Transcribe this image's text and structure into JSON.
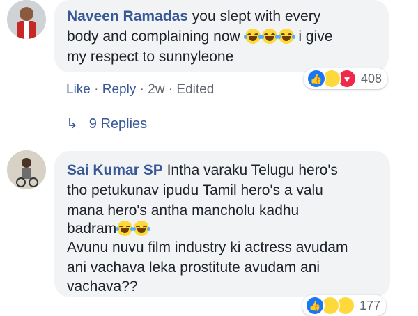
{
  "comments": [
    {
      "author": "Naveen Ramadas",
      "text_line1": " you slept with every",
      "text_line2": "body and complaining now",
      "text_line2_end": " i give",
      "text_line3": "my respect to sunnyleone",
      "emojis": [
        "face-with-tears-of-joy",
        "face-with-tears-of-joy",
        "face-with-tears-of-joy"
      ],
      "reactions": [
        "like",
        "haha",
        "love"
      ],
      "reaction_count": "408",
      "actions": {
        "like": "Like",
        "reply": "Reply",
        "time": "2w",
        "edited": "Edited",
        "sep": "·"
      },
      "replies_label": "9 Replies"
    },
    {
      "author": "Sai Kumar SP",
      "text_line1": " Intha varaku Telugu hero's",
      "text_line2": "tho petukunav ipudu Tamil hero's a valu",
      "text_line3": "mana hero's antha mancholu kadhu",
      "text_line4": "badram",
      "text_line5": "Avunu nuvu film industry ki actress avudam",
      "text_line6": "ani vachava leka prostitute avudam ani",
      "text_line7": "vachava??",
      "emojis": [
        "face-with-tears-of-joy",
        "face-with-tears-of-joy"
      ],
      "reactions": [
        "like",
        "haha",
        "wow"
      ],
      "reaction_count": "177"
    }
  ],
  "colors": {
    "link": "#385898",
    "bubble": "#f2f3f5",
    "like": "#1877f2",
    "love": "#f0284a",
    "haha": "#ffd93b"
  }
}
